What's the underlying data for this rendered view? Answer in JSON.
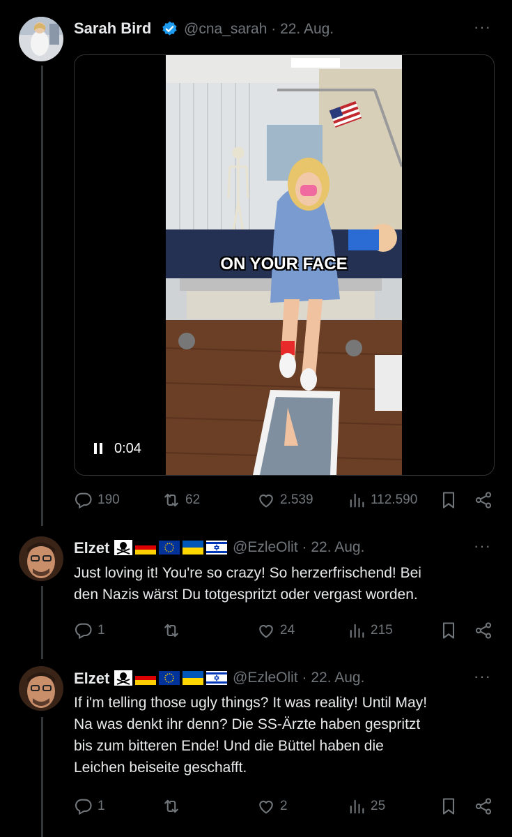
{
  "main_tweet": {
    "author": "Sarah Bird",
    "handle": "@cna_sarah",
    "date": "22. Aug.",
    "video": {
      "caption": "ON YOUR FACE",
      "time": "0:04"
    },
    "stats": {
      "replies": "190",
      "reposts": "62",
      "likes": "2.539",
      "views": "112.590"
    }
  },
  "replies": [
    {
      "author": "Elzet",
      "handle": "@EzleOlit",
      "date": "22. Aug.",
      "lines": [
        "Just loving it! You're so crazy! So herzerfrischend! Bei",
        "den Nazis wärst Du totgespritzt oder vergast worden."
      ],
      "stats": {
        "replies": "1",
        "reposts": "",
        "likes": "24",
        "views": "215"
      }
    },
    {
      "author": "Elzet",
      "handle": "@EzleOlit",
      "date": "22. Aug.",
      "lines": [
        "If i'm telling those ugly things? It was reality! Until May!",
        "Na was denkt ihr denn? Die SS-Ärzte haben gespritzt",
        "bis zum bitteren Ende! Und die Büttel haben die",
        "Leichen beiseite geschafft."
      ],
      "stats": {
        "replies": "1",
        "reposts": "",
        "likes": "2",
        "views": "25"
      }
    }
  ],
  "ui": {
    "more": "···",
    "separator": "·"
  },
  "colors": {
    "background": "#000000",
    "text": "#e7e9ea",
    "muted": "#71767b",
    "verified": "#1d9bf0"
  }
}
